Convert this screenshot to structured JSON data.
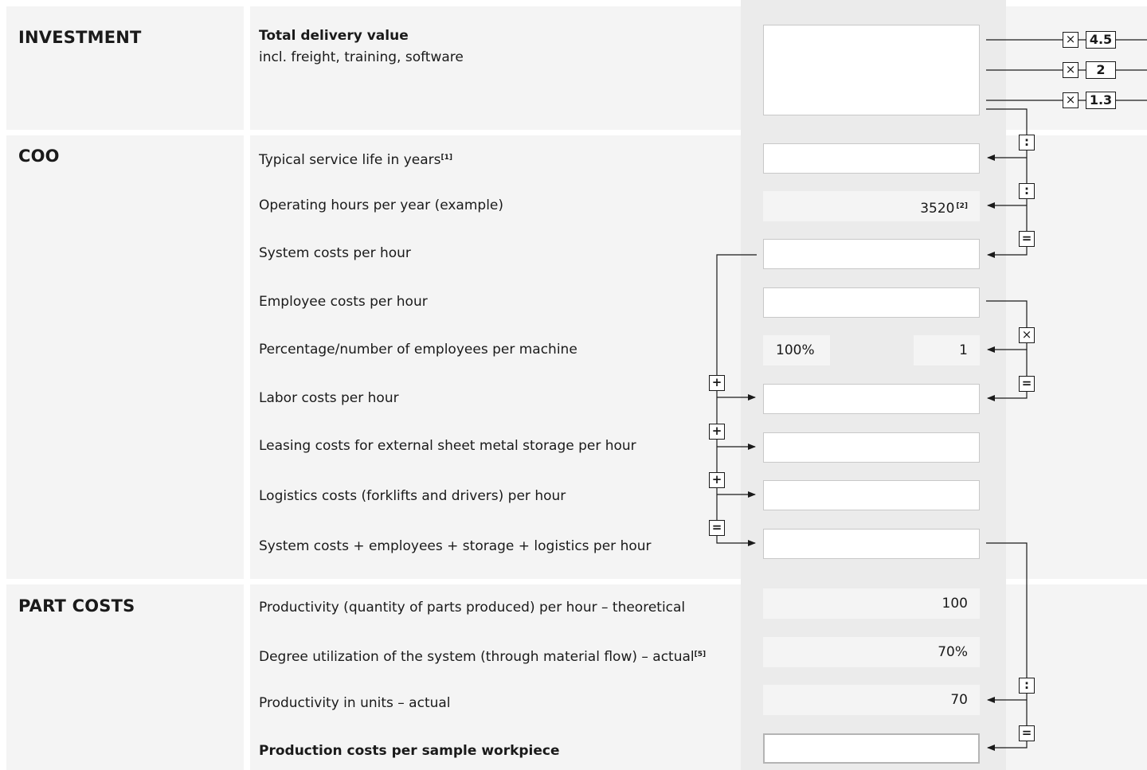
{
  "sections": {
    "investment": {
      "category": "INVESTMENT",
      "title": "Total delivery value",
      "subtitle": "incl. freight, training, software"
    },
    "coo": {
      "category": "COO",
      "rows": [
        {
          "label": "Typical service life in years",
          "note": "[1]"
        },
        {
          "label": "Operating hours per year (example)"
        },
        {
          "label": "System costs per hour"
        },
        {
          "label": "Employee costs per hour"
        },
        {
          "label": "Percentage/number of employees per machine"
        },
        {
          "label": "Labor costs per hour"
        },
        {
          "label": "Leasing costs for external sheet metal storage per hour"
        },
        {
          "label": "Logistics costs (forklifts and drivers) per hour"
        },
        {
          "label": "System costs + employees + storage + logistics per hour"
        }
      ]
    },
    "part_costs": {
      "category": "PART COSTS",
      "rows": [
        {
          "label": "Productivity (quantity of parts produced) per hour – theoretical"
        },
        {
          "label": "Degree utilization of the system (through material flow) – actual",
          "note": "[5]"
        },
        {
          "label": "Productivity in units – actual"
        },
        {
          "label": "Production costs per sample workpiece"
        }
      ]
    }
  },
  "values": {
    "operating_hours": "3520",
    "operating_hours_note": "[2]",
    "employee_percentage": "100%",
    "employee_number": "1",
    "productivity_theoretical": "100",
    "utilization": "70%",
    "productivity_actual": "70"
  },
  "multipliers": [
    "4.5",
    "2",
    "1.3"
  ],
  "operators": {
    "times": "×",
    "divide": ":",
    "equals": "=",
    "plus": "+"
  },
  "colors": {
    "panel_background": "#f4f4f4",
    "input_column": "#ebebeb",
    "input_border": "#c8c8c8"
  }
}
